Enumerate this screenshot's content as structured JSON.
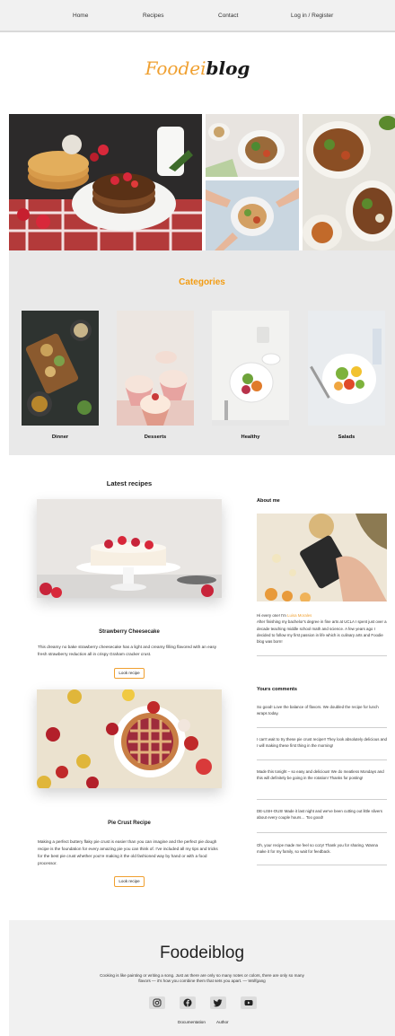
{
  "nav": {
    "home": "Home",
    "recipes": "Recipes",
    "contact": "Contact",
    "login": "Log in / Register"
  },
  "logo": {
    "part1": "Foodei",
    "part2": "blog"
  },
  "categories": {
    "title": "Categories",
    "items": [
      {
        "label": "Dinner"
      },
      {
        "label": "Desserts"
      },
      {
        "label": "Healthy"
      },
      {
        "label": "Salads"
      }
    ]
  },
  "latest": {
    "title": "Latest recipes",
    "recipes": [
      {
        "title": "Strawberry Cheesecake",
        "desc": "This dreamy no bake strawberry cheesecake has a light and creamy filling flavored with an easy fresh strawberry reduction all in crispy Graham cracker crust.",
        "button": "Look recipe"
      },
      {
        "title": "Pie Crust Recipe",
        "desc": "Making a perfect buttery flaky pie crust is easier than you can imagine and the perfect pie dough recipe is the foundation for every amazing pie you can think of. I've included all my tips and tricks for the best pie crust whether you're making it the old fashioned way by hand or with a food processor.",
        "button": "Look recipe"
      }
    ]
  },
  "about": {
    "title": "About me",
    "greeting": "Hi every one! I'm",
    "name": "Luisa Morales",
    "body": "After finishing my bachelor's degree in fine arts at UCLA I spent just over a decade teaching middle school math and science. A few years ago I decided to follow my first passion in life which is culinary arts and Foodie blog was born!"
  },
  "comments": {
    "title": "Yours comments",
    "items": [
      "So good! Love the balance of flavors. We doubled the recipe for lunch wraps today.",
      "I can't wait to try these pie crust recipe!! They look absolutely delicious and I will making these first thing in the morning!",
      "Made this tonight – so easy and delicious! We do meatless Mondays and this will definitely be going in the rotation! Thanks for posting!",
      "DE-LISH-OUS! Made it last night and we've been cutting out little slivers about every couple hours… Too good!",
      "Oh, your recipe made me feel so cozy! Thank you for sharing. Wanna make it for my family, so wait for feedback."
    ]
  },
  "footer": {
    "quote": "Cooking is like painting or writing a song. Just as there are only so many notes or colors, there are only so many flavors — it's how you combine them that sets you apart. — Wolfgang",
    "social": [
      "instagram-icon",
      "facebook-icon",
      "twitter-icon",
      "youtube-icon"
    ],
    "links": {
      "documentation": "Documentation",
      "author": "Author"
    }
  },
  "colors": {
    "accent": "#f39c12",
    "band": "#e9e9e9",
    "nav": "#f1f1f1"
  }
}
